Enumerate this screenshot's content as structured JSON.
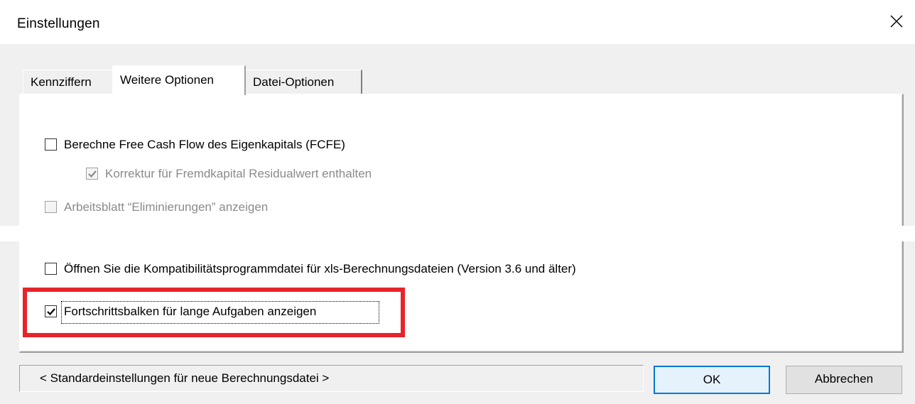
{
  "window": {
    "title": "Einstellungen"
  },
  "tabs": [
    {
      "label": "Kennziffern",
      "active": false
    },
    {
      "label": "Weitere Optionen",
      "active": true
    },
    {
      "label": "Datei-Optionen",
      "active": false
    }
  ],
  "options": {
    "fcfe": {
      "label": "Berechne Free Cash Flow des Eigenkapitals (FCFE)",
      "checked": false,
      "enabled": true
    },
    "korrektur": {
      "label": "Korrektur für Fremdkapital Residualwert enthalten",
      "checked": true,
      "enabled": false
    },
    "eliminierungen": {
      "label": "Arbeitsblatt “Eliminierungen” anzeigen",
      "checked": false,
      "enabled": false
    },
    "kompatibilitaet": {
      "label": "Öffnen Sie die Kompatibilitätsprogrammdatei für xls-Berechnungsdateien (Version 3.6 und älter)",
      "checked": false,
      "enabled": true
    },
    "fortschritt": {
      "label": "Fortschrittsbalken für lange Aufgaben anzeigen",
      "checked": true,
      "enabled": true
    }
  },
  "footer": {
    "status_text": "< Standardeinstellungen für neue Berechnungsdatei >",
    "ok_label": "OK",
    "cancel_label": "Abbrechen"
  },
  "colors": {
    "highlight": "#e8232a",
    "dialog_bg": "#f0f0f0",
    "default_button_border": "#0078d7"
  },
  "icons": {
    "close": "close-icon",
    "checkmark": "checkmark-icon"
  }
}
